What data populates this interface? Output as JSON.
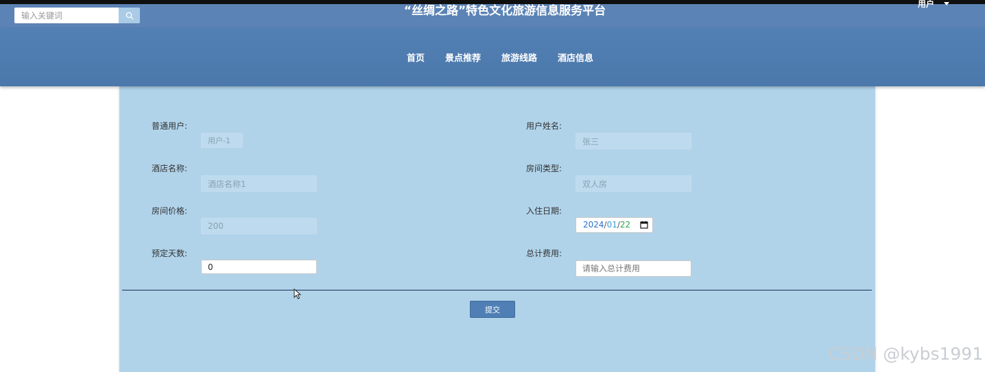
{
  "header": {
    "site_title": "“丝绸之路”特色文化旅游信息服务平台",
    "search": {
      "placeholder": "输入关键词",
      "value": ""
    },
    "user_menu_label": "用户"
  },
  "nav": {
    "items": [
      {
        "label": "首页"
      },
      {
        "label": "景点推荐"
      },
      {
        "label": "旅游线路"
      },
      {
        "label": "酒店信息"
      }
    ]
  },
  "form": {
    "user": {
      "label": "普通用户:",
      "value": "用户-1"
    },
    "user_name": {
      "label": "用户姓名:",
      "value": "张三"
    },
    "hotel_name": {
      "label": "酒店名称:",
      "value": "酒店名称1"
    },
    "room_type": {
      "label": "房间类型:",
      "value": "双人房"
    },
    "room_price": {
      "label": "房间价格:",
      "value": "200"
    },
    "checkin_date": {
      "label": "入住日期:",
      "year": "2024",
      "month": "01",
      "day": "22",
      "sep": "/"
    },
    "days": {
      "label": "预定天数:",
      "value": "0"
    },
    "total_cost": {
      "label": "总计费用:",
      "placeholder": "请输入总计费用",
      "value": ""
    },
    "submit_label": "提交"
  },
  "watermark": "CSDN @kybs1991",
  "colors": {
    "header_bg": "#5b83b5",
    "nav_bg": "#4b78ab",
    "panel_bg": "#b0d3ea",
    "button_bg": "#4f7fb4"
  }
}
